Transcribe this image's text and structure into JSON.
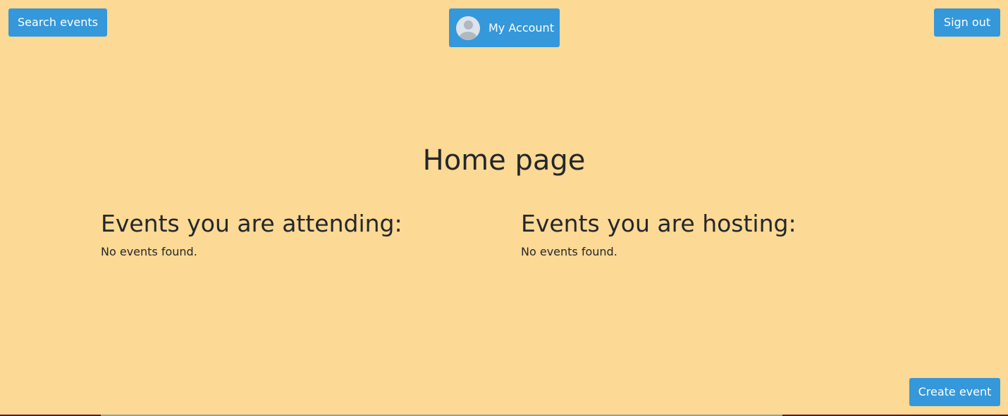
{
  "header": {
    "search_label": "Search events",
    "account_label": "My Account",
    "signout_label": "Sign out"
  },
  "main": {
    "title": "Home page",
    "attending": {
      "heading": "Events you are attending:",
      "empty_text": "No events found."
    },
    "hosting": {
      "heading": "Events you are hosting:",
      "empty_text": "No events found."
    }
  },
  "footer": {
    "create_label": "Create event"
  },
  "colors": {
    "background": "#fcd994",
    "button": "#3498db",
    "text": "#23272b"
  },
  "icons": {
    "avatar": "user-avatar-icon"
  }
}
